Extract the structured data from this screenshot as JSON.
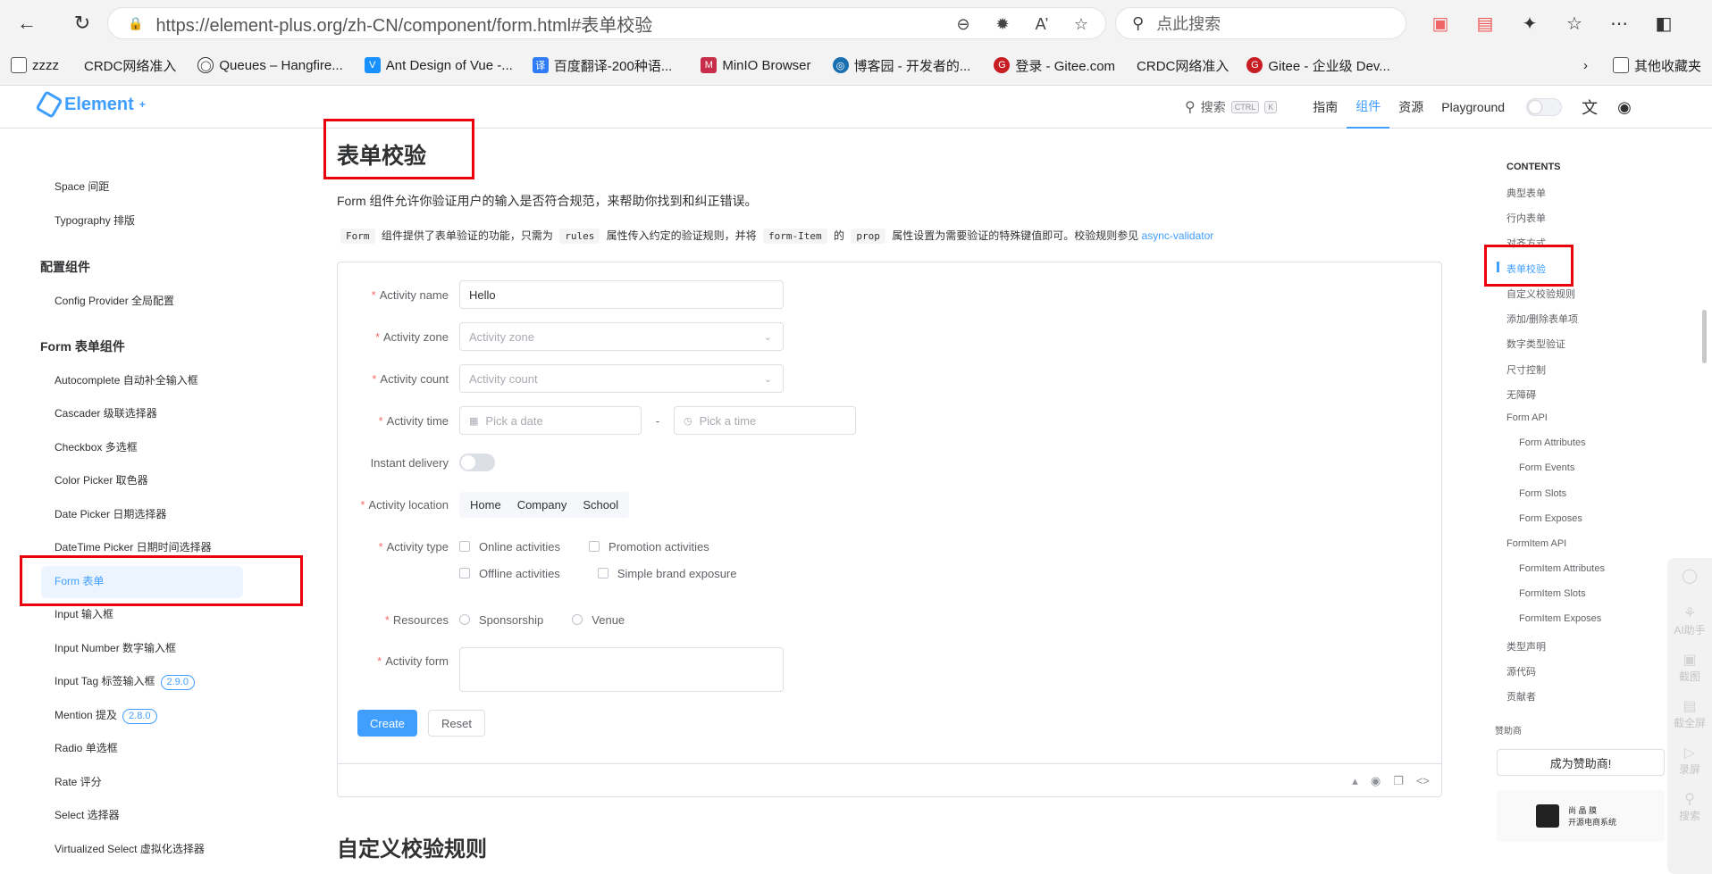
{
  "browser": {
    "url": "https://element-plus.org/zh-CN/component/form.html#表单校验",
    "search_placeholder": "点此搜索",
    "bookmarks": [
      "zzzz",
      "CRDC网络准入",
      "Queues – Hangfire...",
      "Ant Design of Vue -...",
      "百度翻译-200种语...",
      "MinIO Browser",
      "博客园 - 开发者的...",
      "登录 - Gitee.com",
      "CRDC网络准入",
      "Gitee - 企业级 Dev..."
    ],
    "bookmarks_more": "其他收藏夹"
  },
  "header": {
    "logo": "Element",
    "search_label": "搜索",
    "kbd1": "CTRL",
    "kbd2": "K",
    "nav": [
      "指南",
      "组件",
      "资源",
      "Playground"
    ]
  },
  "sidebar": {
    "items": [
      {
        "label": "Space 间距"
      },
      {
        "label": "Typography 排版"
      },
      {
        "label": "Config Provider 全局配置"
      },
      {
        "label": "Autocomplete 自动补全输入框"
      },
      {
        "label": "Cascader 级联选择器"
      },
      {
        "label": "Checkbox 多选框"
      },
      {
        "label": "Color Picker 取色器"
      },
      {
        "label": "Date Picker 日期选择器"
      },
      {
        "label": "DateTime Picker 日期时间选择器"
      },
      {
        "label": "Form 表单"
      },
      {
        "label": "Input 输入框"
      },
      {
        "label": "Input Number 数字输入框"
      },
      {
        "label": "Input Tag 标签输入框",
        "badge": "2.9.0"
      },
      {
        "label": "Mention 提及",
        "badge": "2.8.0"
      },
      {
        "label": "Radio 单选框"
      },
      {
        "label": "Rate 评分"
      },
      {
        "label": "Select 选择器"
      },
      {
        "label": "Virtualized Select 虚拟化选择器"
      }
    ],
    "groups": [
      "配置组件",
      "Form 表单组件"
    ]
  },
  "main": {
    "title": "表单校验",
    "desc": "Form 组件允许你验证用户的输入是否符合规范，来帮助你找到和纠正错误。",
    "desc2_a": "Form",
    "desc2_b": "组件提供了表单验证的功能，只需为",
    "desc2_c": "rules",
    "desc2_d": "属性传入约定的验证规则，并将",
    "desc2_e": "form-Item",
    "desc2_f": "的",
    "desc2_g": "prop",
    "desc2_h": "属性设置为需要验证的特殊键值即可。校验规则参见",
    "desc2_link": "async-validator",
    "next_section": "自定义校验规则"
  },
  "form": {
    "name_label": "Activity name",
    "name_value": "Hello",
    "zone_label": "Activity zone",
    "zone_placeholder": "Activity zone",
    "count_label": "Activity count",
    "count_placeholder": "Activity count",
    "time_label": "Activity time",
    "date_placeholder": "Pick a date",
    "time_sep": "-",
    "time_placeholder": "Pick a time",
    "delivery_label": "Instant delivery",
    "location_label": "Activity location",
    "locations": [
      "Home",
      "Company",
      "School"
    ],
    "type_label": "Activity type",
    "types": [
      "Online activities",
      "Promotion activities",
      "Offline activities",
      "Simple brand exposure"
    ],
    "resources_label": "Resources",
    "resources": [
      "Sponsorship",
      "Venue"
    ],
    "form_label": "Activity form",
    "create_btn": "Create",
    "reset_btn": "Reset"
  },
  "toc": {
    "heading": "CONTENTS",
    "items": [
      "典型表单",
      "行内表单",
      "对齐方式",
      "表单校验",
      "自定义校验规则",
      "添加/删除表单项",
      "数字类型验证",
      "尺寸控制",
      "无障碍",
      "Form API",
      "Form Attributes",
      "Form Events",
      "Form Slots",
      "Form Exposes",
      "FormItem API",
      "FormItem Attributes",
      "FormItem Slots",
      "FormItem Exposes",
      "类型声明",
      "源代码",
      "贡献者"
    ],
    "sponsor_heading": "赞助商",
    "sponsor_btn": "成为赞助商!",
    "sponsor1_a": "尚 晶 膜",
    "sponsor1_b": "开源电商系统"
  },
  "floating": [
    "AI助手",
    "截图",
    "截全屏",
    "录屏",
    "搜索"
  ]
}
